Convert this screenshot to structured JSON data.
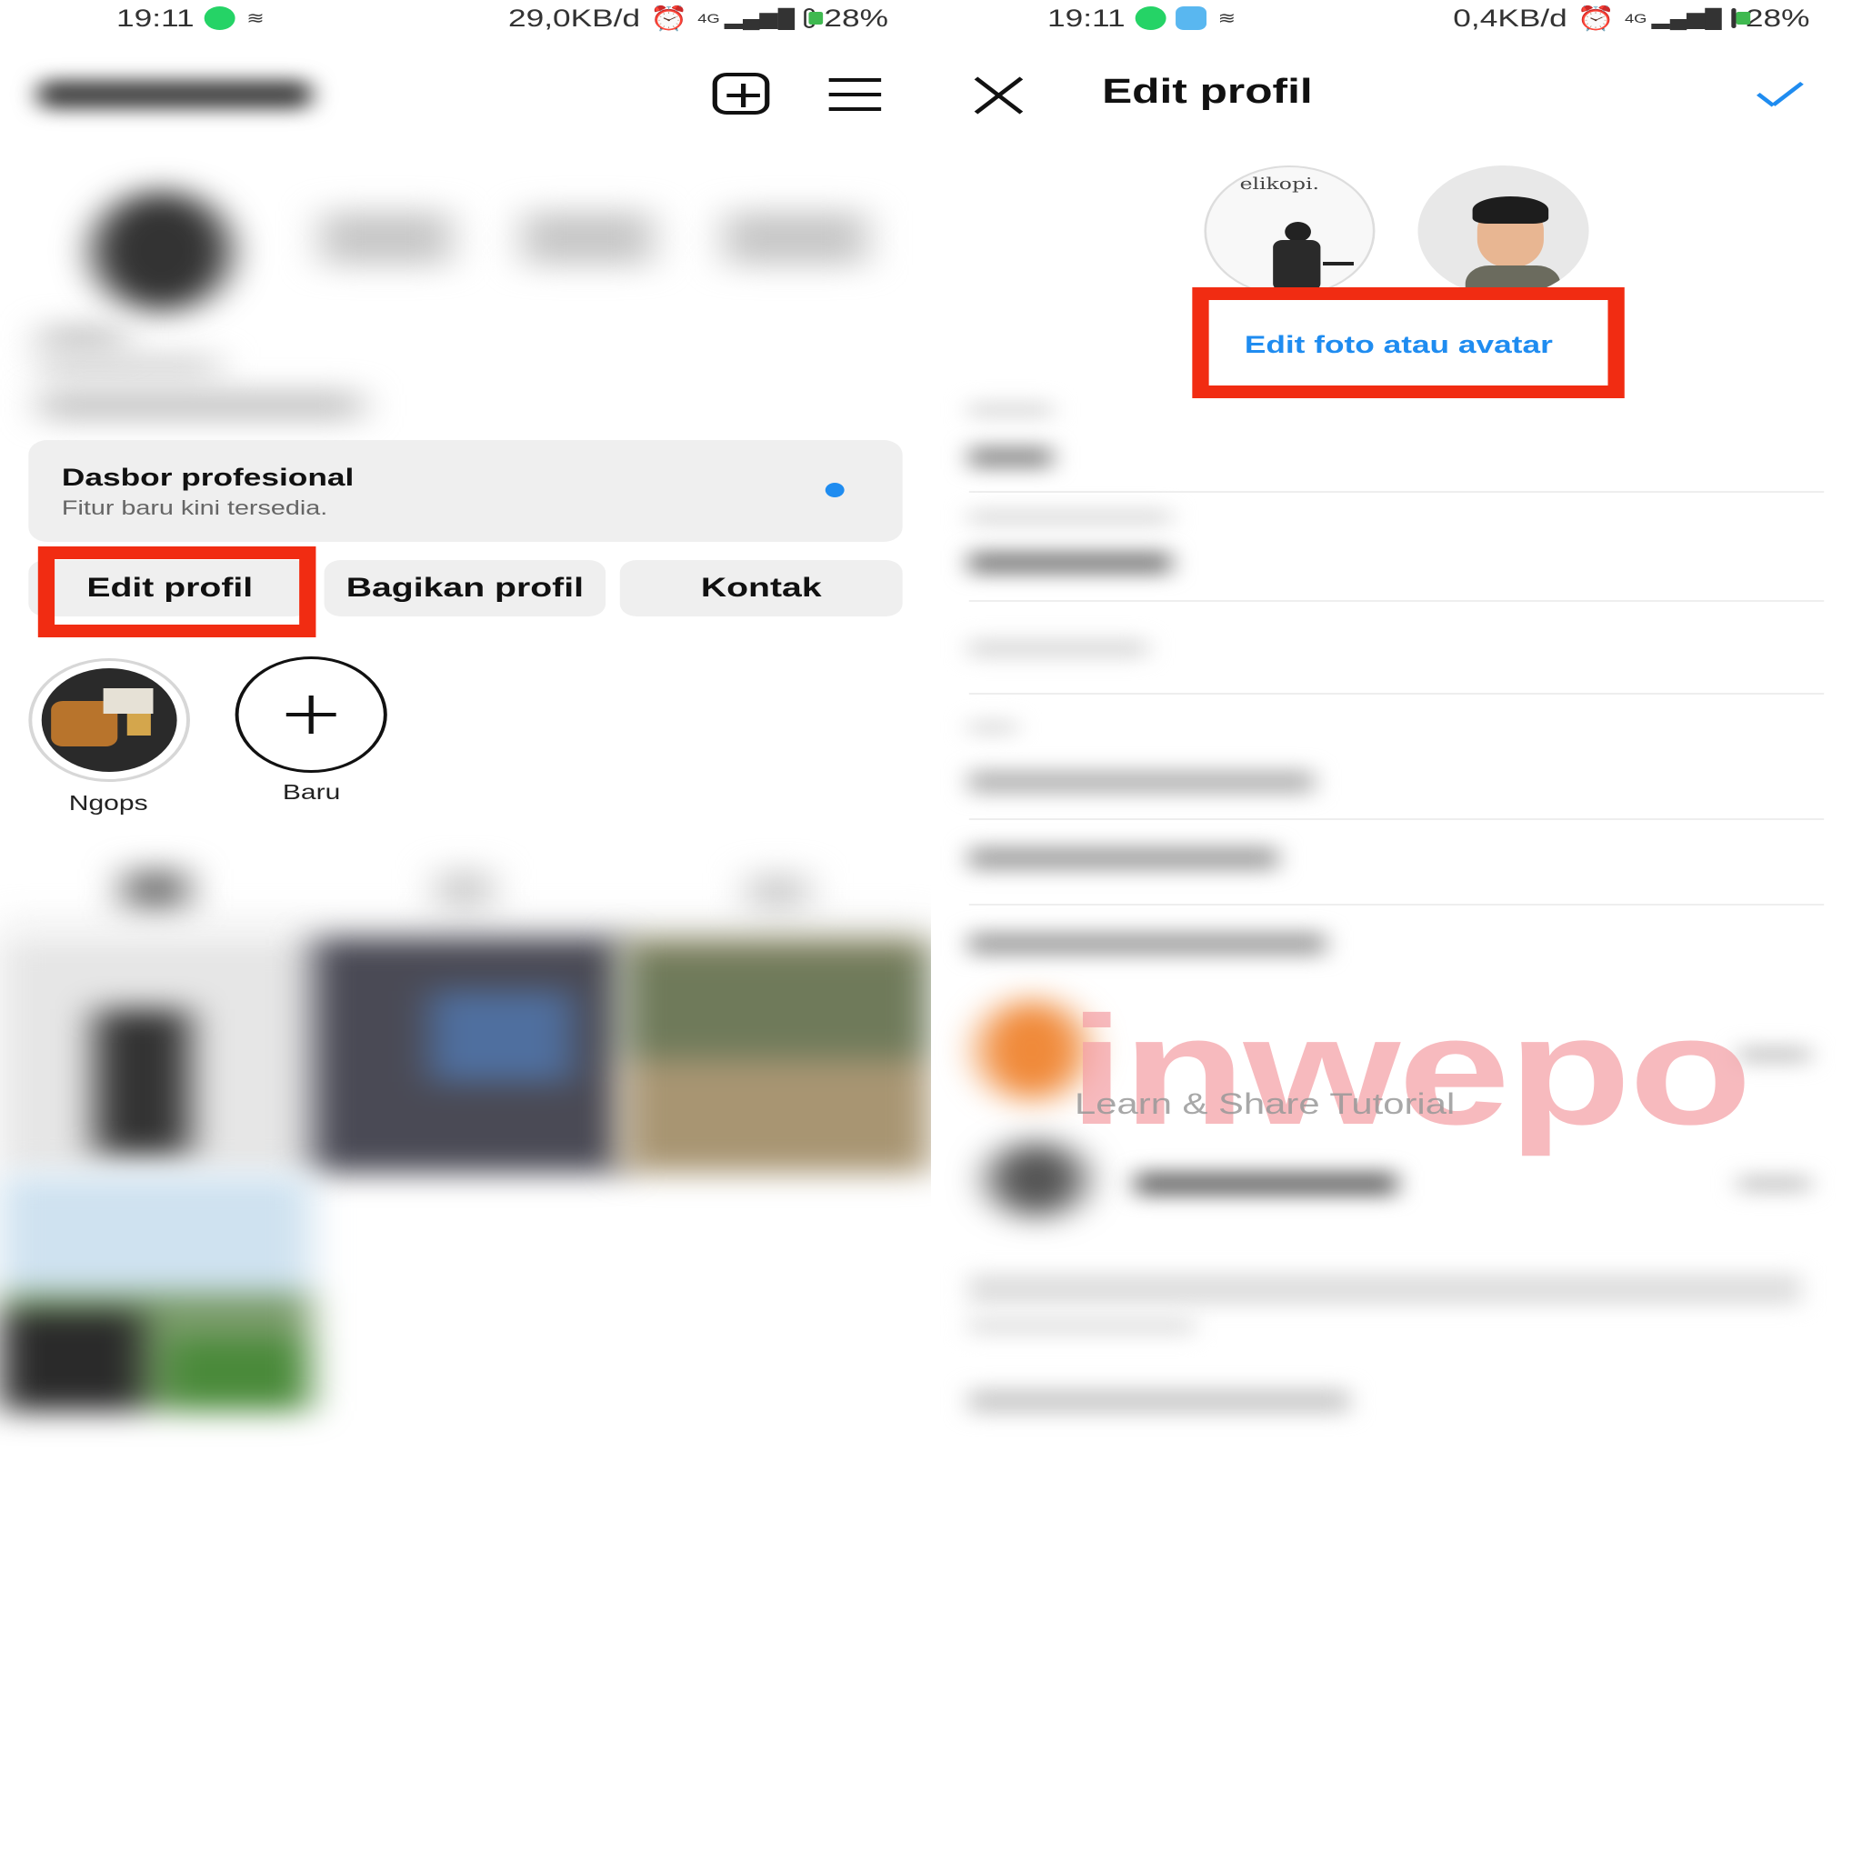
{
  "left": {
    "status": {
      "time": "19:11",
      "speed": "29,0KB/d",
      "network": "4G",
      "battery": "28%"
    },
    "toolbar": {
      "add_icon": "plus-square-icon",
      "menu_icon": "hamburger-menu-icon"
    },
    "dashboard": {
      "title": "Dasbor profesional",
      "subtitle": "Fitur baru kini tersedia."
    },
    "buttons": {
      "edit": "Edit profil",
      "share": "Bagikan profil",
      "contact": "Kontak"
    },
    "highlights": [
      {
        "label": "Ngops"
      },
      {
        "label": "Baru"
      }
    ]
  },
  "right": {
    "status": {
      "time": "19:11",
      "speed": "0,4KB/d",
      "network": "4G",
      "battery": "28%"
    },
    "header": {
      "title": "Edit profil",
      "close_icon": "close-icon",
      "confirm_icon": "check-icon"
    },
    "avatar_photo_text": "elikopi.",
    "edit_photo_link": "Edit foto atau avatar"
  },
  "watermark": {
    "brand": "inwepo",
    "tagline": "Learn & Share Tutorial"
  },
  "colors": {
    "accent": "#1f8cf0",
    "highlight_box": "#f12c12",
    "card_bg": "#efefef"
  }
}
